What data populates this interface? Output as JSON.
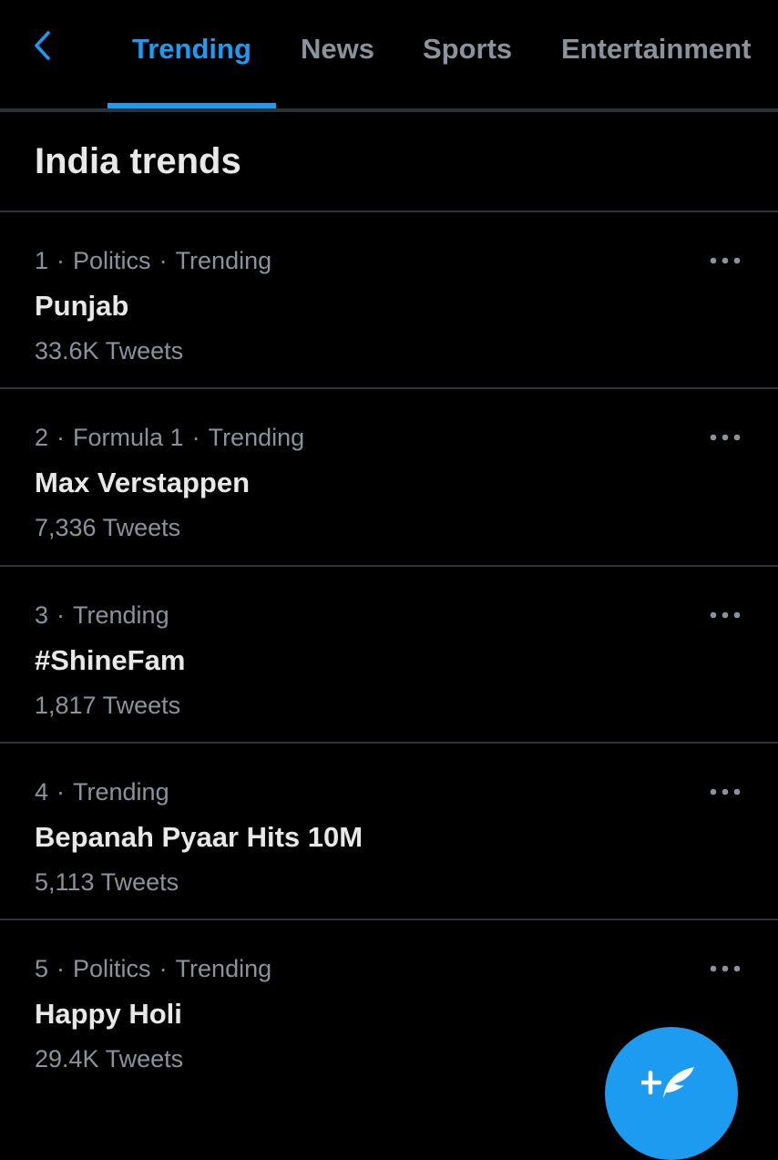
{
  "header": {
    "tabs": [
      {
        "label": "Trending",
        "active": true
      },
      {
        "label": "News",
        "active": false
      },
      {
        "label": "Sports",
        "active": false
      },
      {
        "label": "Entertainment",
        "active": false
      }
    ],
    "back_icon": "chevron-left-icon"
  },
  "section": {
    "title": "India trends"
  },
  "trends": [
    {
      "rank": "1",
      "category": "Politics",
      "status": "Trending",
      "name": "Punjab",
      "count": "33.6K Tweets"
    },
    {
      "rank": "2",
      "category": "Formula 1",
      "status": "Trending",
      "name": "Max Verstappen",
      "count": "7,336 Tweets"
    },
    {
      "rank": "3",
      "category": "",
      "status": "Trending",
      "name": "#ShineFam",
      "count": "1,817 Tweets"
    },
    {
      "rank": "4",
      "category": "",
      "status": "Trending",
      "name": "Bepanah Pyaar Hits 10M",
      "count": "5,113 Tweets"
    },
    {
      "rank": "5",
      "category": "Politics",
      "status": "Trending",
      "name": "Happy Holi",
      "count": "29.4K Tweets"
    }
  ],
  "fab": {
    "icon": "compose-tweet-icon"
  },
  "colors": {
    "accent": "#1d9bf0",
    "background": "#000000",
    "divider": "#2c3238",
    "muted_text": "#8a939c",
    "primary_text": "#e8e8e8"
  }
}
